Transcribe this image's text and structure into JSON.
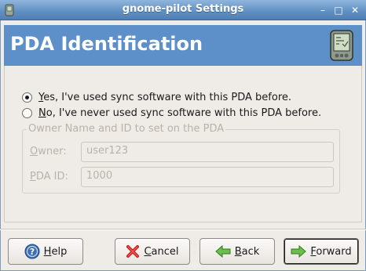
{
  "window": {
    "title": "gnome-pilot Settings",
    "controls": {
      "minimize": "–",
      "maximize": "□",
      "close": "✕"
    }
  },
  "header": {
    "title": "PDA Identification",
    "background": "#5d90c8"
  },
  "options": {
    "yes": {
      "mnemonic": "Y",
      "rest": "es, I've used sync software with this PDA before.",
      "checked": true
    },
    "no": {
      "mnemonic": "N",
      "rest": "o, I've never used sync software with this PDA before.",
      "checked": false
    }
  },
  "owner_group": {
    "legend": "Owner Name and ID to set on the PDA",
    "owner": {
      "mnemonic": "O",
      "rest": "wner:",
      "value": "user123"
    },
    "pda_id": {
      "mnemonic": "P",
      "rest": "DA ID:",
      "value": "1000"
    },
    "disabled": true
  },
  "buttons": {
    "help": {
      "mnemonic": "H",
      "rest": "elp",
      "icon": "help-icon"
    },
    "cancel": {
      "mnemonic": "C",
      "rest": "ancel",
      "icon": "cancel-icon"
    },
    "back": {
      "mnemonic": "B",
      "rest": "ack",
      "icon": "back-arrow-icon"
    },
    "forward": {
      "mnemonic": "F",
      "rest": "orward",
      "icon": "forward-arrow-icon"
    }
  }
}
